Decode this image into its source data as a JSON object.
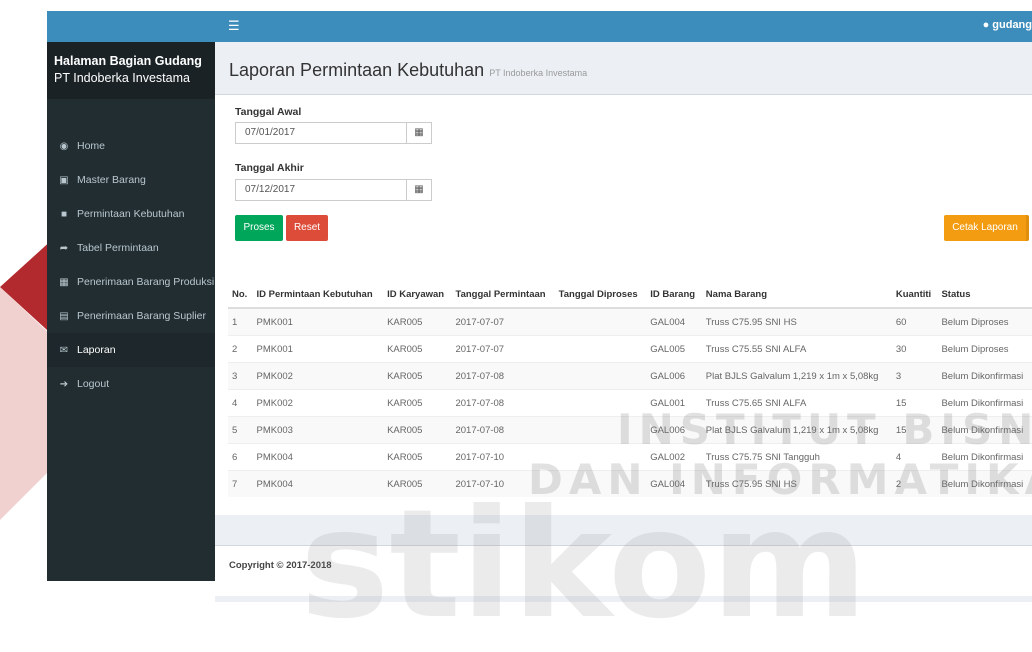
{
  "topbar": {
    "menu_icon": "bars-icon",
    "user_label": "gudang",
    "user_icon": "user-icon"
  },
  "sidebar": {
    "brand_line1": "Halaman Bagian Gudang",
    "brand_line2": "PT Indoberka Investama",
    "items": [
      {
        "label": "Home",
        "icon": "dashboard-icon"
      },
      {
        "label": "Master Barang",
        "icon": "cube-icon"
      },
      {
        "label": "Permintaan Kebutuhan",
        "icon": "folder-icon"
      },
      {
        "label": "Tabel Permintaan",
        "icon": "share-icon"
      },
      {
        "label": "Penerimaan Barang Produksi",
        "icon": "table-icon"
      },
      {
        "label": "Penerimaan Barang Suplier",
        "icon": "calendar-icon"
      },
      {
        "label": "Laporan",
        "icon": "envelope-icon"
      },
      {
        "label": "Logout",
        "icon": "sign-out-icon"
      }
    ]
  },
  "page": {
    "title": "Laporan Permintaan Kebutuhan",
    "subtitle": "PT Indoberka Investama"
  },
  "form": {
    "start_label": "Tanggal Awal",
    "start_value": "07/01/2017",
    "end_label": "Tanggal Akhir",
    "end_value": "07/12/2017",
    "process_label": "Proses",
    "reset_label": "Reset",
    "print_label": "Cetak Laporan"
  },
  "table": {
    "headers": [
      "No.",
      "ID Permintaan Kebutuhan",
      "ID Karyawan",
      "Tanggal Permintaan",
      "Tanggal Diproses",
      "ID Barang",
      "Nama Barang",
      "Kuantiti",
      "Status"
    ],
    "rows": [
      [
        "1",
        "PMK001",
        "KAR005",
        "2017-07-07",
        "",
        "GAL004",
        "Truss C75.95 SNI HS",
        "60",
        "Belum Diproses"
      ],
      [
        "2",
        "PMK001",
        "KAR005",
        "2017-07-07",
        "",
        "GAL005",
        "Truss C75.55 SNI ALFA",
        "30",
        "Belum Diproses"
      ],
      [
        "3",
        "PMK002",
        "KAR005",
        "2017-07-08",
        "",
        "GAL006",
        "Plat BJLS Galvalum 1,219 x 1m x 5,08kg",
        "3",
        "Belum Dikonfirmasi"
      ],
      [
        "4",
        "PMK002",
        "KAR005",
        "2017-07-08",
        "",
        "GAL001",
        "Truss C75.65 SNI ALFA",
        "15",
        "Belum Dikonfirmasi"
      ],
      [
        "5",
        "PMK003",
        "KAR005",
        "2017-07-08",
        "",
        "GAL006",
        "Plat BJLS Galvalum 1,219 x 1m x 5,08kg",
        "15",
        "Belum Dikonfirmasi"
      ],
      [
        "6",
        "PMK004",
        "KAR005",
        "2017-07-10",
        "",
        "GAL002",
        "Truss C75.75 SNI Tangguh",
        "4",
        "Belum Dikonfirmasi"
      ],
      [
        "7",
        "PMK004",
        "KAR005",
        "2017-07-10",
        "",
        "GAL004",
        "Truss C75.95 SNI HS",
        "2",
        "Belum Dikonfirmasi"
      ]
    ]
  },
  "footer": {
    "copyright": "Copyright © 2017-2018"
  },
  "watermark": {
    "line1": "INSTITUT BISNIS",
    "line2": "DAN INFORMATIKA",
    "word": "stikom"
  },
  "colors": {
    "primary": "#3c8dbc",
    "sidebar": "#222d32",
    "success": "#00a65a",
    "danger": "#dd4b39",
    "warning": "#f39c12"
  }
}
